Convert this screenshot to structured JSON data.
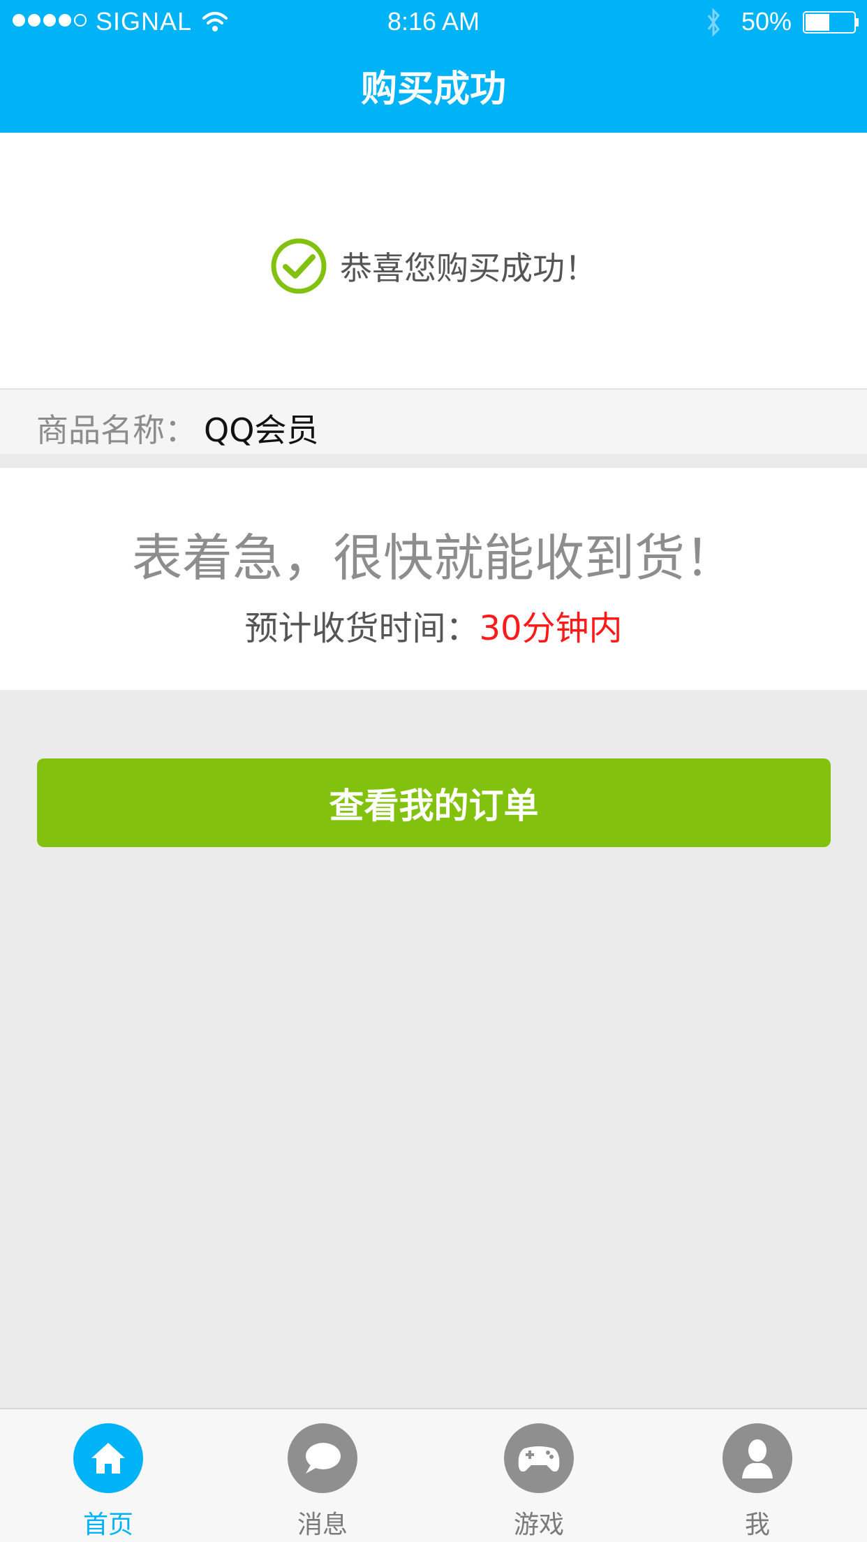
{
  "status_bar": {
    "carrier": "SIGNAL",
    "time": "8:16 AM",
    "battery": "50%"
  },
  "nav": {
    "title": "购买成功"
  },
  "success": {
    "message": "恭喜您购买成功！"
  },
  "product": {
    "label": "商品名称：",
    "value": "QQ会员"
  },
  "info": {
    "headline": "表着急，很快就能收到货！",
    "eta_label": "预计收货时间：",
    "eta_value": "30分钟内"
  },
  "actions": {
    "view_orders": "查看我的订单"
  },
  "tabbar": {
    "items": [
      {
        "label": "首页",
        "icon": "home-icon",
        "active": true
      },
      {
        "label": "消息",
        "icon": "message-icon",
        "active": false
      },
      {
        "label": "游戏",
        "icon": "gamepad-icon",
        "active": false
      },
      {
        "label": "我",
        "icon": "user-icon",
        "active": false
      }
    ]
  },
  "colors": {
    "primary": "#00b3f6",
    "success_green": "#82c20f",
    "eta_red": "#ff1a1a",
    "background": "#ebebeb"
  }
}
